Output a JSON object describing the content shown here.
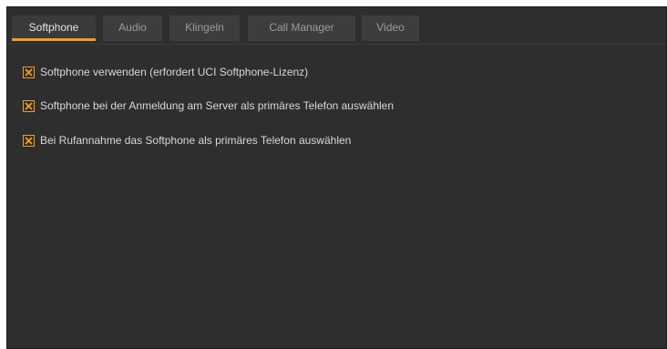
{
  "tabs": [
    {
      "label": "Softphone",
      "active": true
    },
    {
      "label": "Audio",
      "active": false
    },
    {
      "label": "Klingeln",
      "active": false
    },
    {
      "label": "Call Manager",
      "active": false
    },
    {
      "label": "Video",
      "active": false
    }
  ],
  "softphone": {
    "options": [
      {
        "label": "Softphone verwenden (erfordert UCI Softphone-Lizenz)",
        "checked": true
      },
      {
        "label": "Softphone bei der Anmeldung am Server als primäres Telefon auswählen",
        "checked": true
      },
      {
        "label": "Bei Rufannahme das Softphone als primäres Telefon auswählen",
        "checked": true
      }
    ]
  },
  "colors": {
    "background": "#2e2e2e",
    "tab_background": "#3d3d3d",
    "accent": "#f0a020",
    "text": "#d8d8d8",
    "tab_text": "#9a9a9a"
  }
}
